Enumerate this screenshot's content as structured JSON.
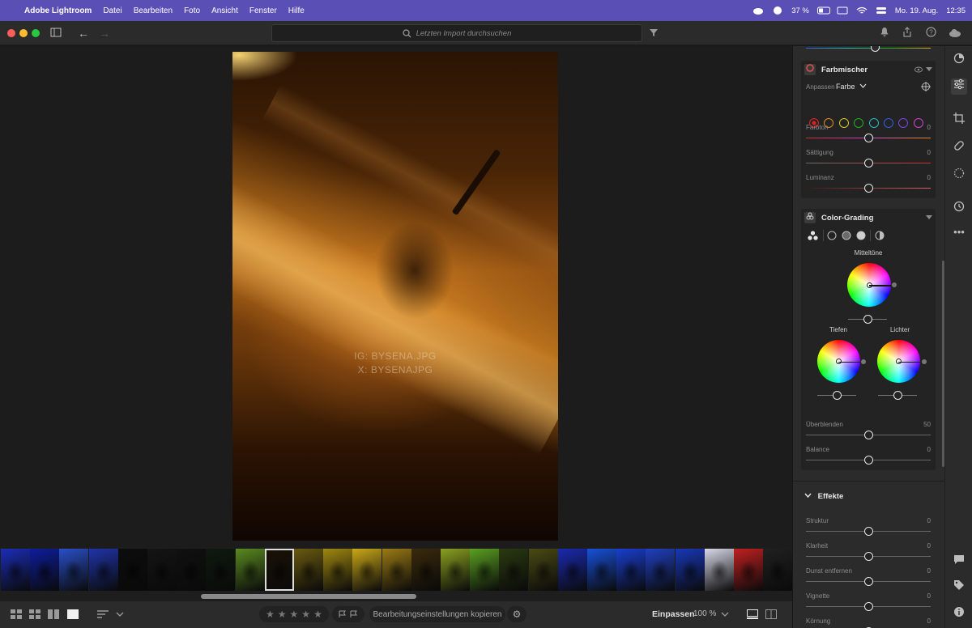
{
  "menubar": {
    "app_name": "Adobe Lightroom",
    "items": [
      "Datei",
      "Bearbeiten",
      "Foto",
      "Ansicht",
      "Fenster",
      "Hilfe"
    ],
    "battery": "37 %",
    "datetime": "Mo. 19. Aug.",
    "time": "12:35"
  },
  "titlebar": {
    "search_placeholder": "Letzten Import durchsuchen"
  },
  "photo": {
    "watermark_line1": "IG: BYSENA.JPG",
    "watermark_line2": "X: BYSENAJPG"
  },
  "filmstrip": {
    "selected_index": 9,
    "thumb_colors": [
      "#1b2db8",
      "#0d1d9c",
      "#2a4fc8",
      "#2034a8",
      "#0c0c0c",
      "#141414",
      "#101010",
      "#0e1a0e",
      "#5a8a20",
      "#1a1206",
      "#6a5a10",
      "#a08810",
      "#caa818",
      "#9a7a14",
      "#3a2a0a",
      "#8aa020",
      "#5aa020",
      "#2a3a10",
      "#4a4a14",
      "#1a2ab0",
      "#1850d8",
      "#1a3ed0",
      "#2040c0",
      "#1838b8",
      "#d8d8e8",
      "#c02020",
      "#202020"
    ]
  },
  "bottombar": {
    "copy_label": "Bearbeitungseinstellungen kopieren",
    "fit_label": "Einpassen",
    "zoom_label": "100 %"
  },
  "panel": {
    "farbmischer": {
      "title": "Farbmischer",
      "adjust_label": "Anpassen",
      "adjust_value": "Farbe",
      "color_dots": [
        "#e02020",
        "#e08a20",
        "#d8c820",
        "#20b020",
        "#20c0c0",
        "#3060e0",
        "#8040e0",
        "#d040d0"
      ],
      "sliders": [
        {
          "label": "Farbton",
          "value": "0",
          "fraction": 0.5
        },
        {
          "label": "Sättigung",
          "value": "0",
          "fraction": 0.5
        },
        {
          "label": "Luminanz",
          "value": "0",
          "fraction": 0.5
        }
      ]
    },
    "color_grading": {
      "title": "Color-Grading",
      "mid_label": "Mitteltöne",
      "shadows_label": "Tiefen",
      "highlights_label": "Lichter",
      "sliders": [
        {
          "label": "Überblenden",
          "value": "50",
          "fraction": 0.5
        },
        {
          "label": "Balance",
          "value": "0",
          "fraction": 0.5
        }
      ]
    },
    "effekte": {
      "title": "Effekte",
      "sliders": [
        {
          "label": "Struktur",
          "value": "0",
          "fraction": 0.5
        },
        {
          "label": "Klarheit",
          "value": "0",
          "fraction": 0.5
        },
        {
          "label": "Dunst entfernen",
          "value": "0",
          "fraction": 0.5
        },
        {
          "label": "Vignette",
          "value": "0",
          "fraction": 0.5
        },
        {
          "label": "Körnung",
          "value": "0",
          "fraction": 0.5
        }
      ]
    }
  },
  "colors": {
    "menubar": "#5a4fb4",
    "panel_bg": "#2b2b2b",
    "accent": "#e6e6e6"
  }
}
